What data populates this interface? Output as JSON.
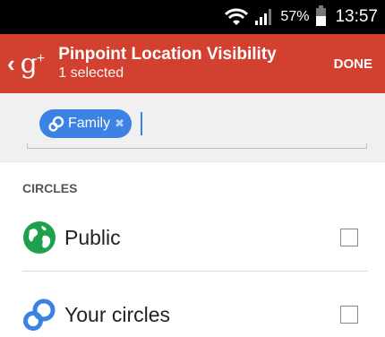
{
  "status_bar": {
    "battery_percent": "57%",
    "battery_level": 0.57,
    "time": "13:57",
    "icons": [
      "wifi-icon",
      "signal-icon",
      "battery-icon"
    ]
  },
  "app_bar": {
    "back_glyph": "‹",
    "logo_text": "g",
    "logo_plus": "+",
    "title": "Pinpoint Location Visibility",
    "subtitle": "1 selected",
    "done_label": "DONE",
    "color": "#d2402f"
  },
  "chip_input": {
    "chips": [
      {
        "label": "Family",
        "remove_glyph": "✖",
        "icon": "circles-icon",
        "color": "#3b82e4"
      }
    ]
  },
  "circles": {
    "section_title": "CIRCLES",
    "items": [
      {
        "label": "Public",
        "icon": "globe-icon",
        "checked": false,
        "color": "#1fa04b"
      },
      {
        "label": "Your circles",
        "icon": "circles-icon",
        "checked": false,
        "color": "#3b82e4"
      }
    ]
  }
}
